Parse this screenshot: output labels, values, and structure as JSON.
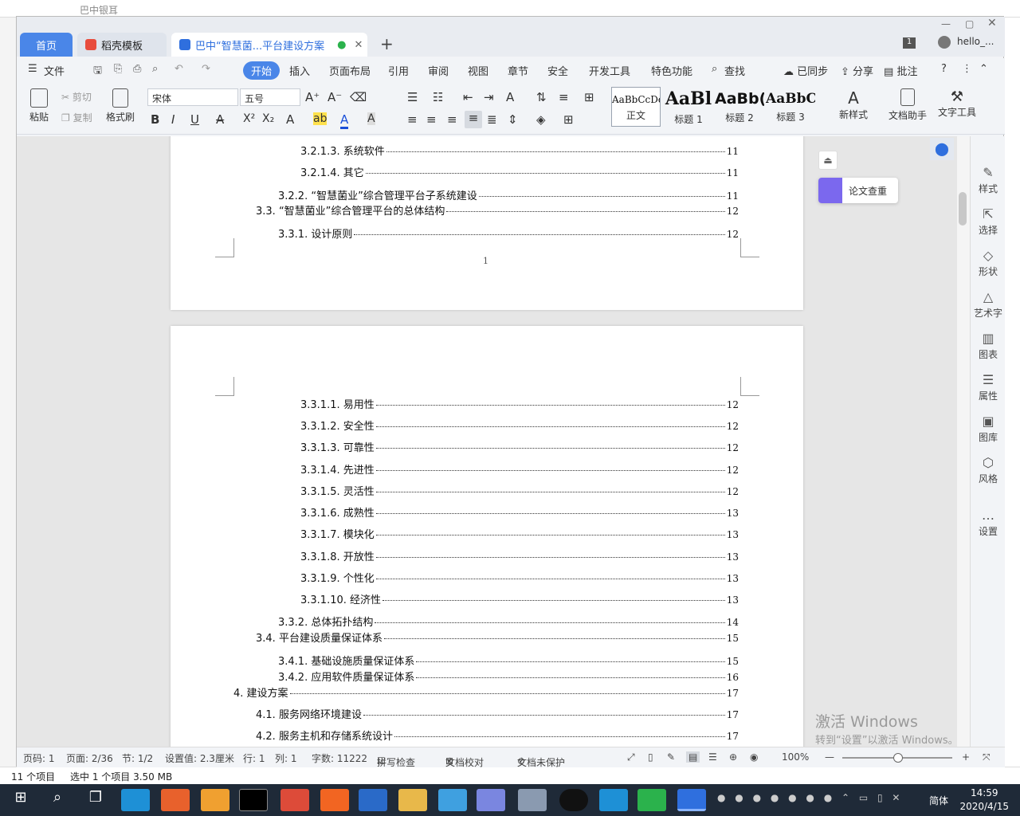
{
  "explorer": {
    "title": "巴中银耳",
    "status_items": "11 个项目",
    "status_selected": "选中 1 个项目  3.50 MB"
  },
  "tabs": {
    "home": "首页",
    "template": "稻壳模板",
    "doc": "巴中“智慧菌...平台建设方案",
    "page_badge": "1",
    "user": "hello_..."
  },
  "ribbon_tabs": [
    "文件",
    "开始",
    "插入",
    "页面布局",
    "引用",
    "审阅",
    "视图",
    "章节",
    "安全",
    "开发工具",
    "特色功能",
    "查找"
  ],
  "ribbon_right": {
    "sync": "已同步",
    "share": "分享",
    "comment": "批注"
  },
  "toolbar": {
    "paste": "粘贴",
    "cut": "剪切",
    "copy": "复制",
    "format_painter": "格式刷",
    "font": "宋体",
    "size": "五号",
    "styles": [
      {
        "preview": "AaBbCcDd",
        "label": "正文"
      },
      {
        "preview": "AaBl",
        "label": "标题 1"
      },
      {
        "preview": "AaBb(",
        "label": "标题 2"
      },
      {
        "preview": "AaBbC",
        "label": "标题 3"
      }
    ],
    "new_style": "新样式",
    "doc_assist": "文档助手",
    "text_tools": "文字工具"
  },
  "page1": {
    "toc": [
      {
        "text": "3.2.1.3.  系统软件",
        "page": "11"
      },
      {
        "text": "3.2.1.4.  其它",
        "page": "11"
      },
      {
        "text": "3.2.2.  “智慧菌业”综合管理平台子系统建设",
        "page": "11"
      },
      {
        "text": "3.3.  “智慧菌业”综合管理平台的总体结构",
        "page": "12"
      },
      {
        "text": "3.3.1.  设计原则",
        "page": "12"
      }
    ],
    "page_number": "1"
  },
  "page2": {
    "toc": [
      {
        "text": "3.3.1.1.  易用性",
        "page": "12"
      },
      {
        "text": "3.3.1.2.  安全性",
        "page": "12"
      },
      {
        "text": "3.3.1.3.  可靠性",
        "page": "12"
      },
      {
        "text": "3.3.1.4.  先进性",
        "page": "12"
      },
      {
        "text": "3.3.1.5.  灵活性",
        "page": "12"
      },
      {
        "text": "3.3.1.6.  成熟性",
        "page": "13"
      },
      {
        "text": "3.3.1.7.  模块化",
        "page": "13"
      },
      {
        "text": "3.3.1.8.  开放性",
        "page": "13"
      },
      {
        "text": "3.3.1.9.  个性化",
        "page": "13"
      },
      {
        "text": "3.3.1.10.  经济性",
        "page": "13"
      },
      {
        "text": "3.3.2.  总体拓扑结构",
        "page": "14"
      },
      {
        "text": "3.4.  平台建设质量保证体系",
        "page": "15"
      },
      {
        "text": "3.4.1.  基础设施质量保证体系",
        "page": "15"
      },
      {
        "text": "3.4.2.  应用软件质量保证体系",
        "page": "16"
      },
      {
        "text": "4.  建设方案",
        "page": "17"
      },
      {
        "text": "4.1.  服务网络环境建设",
        "page": "17"
      },
      {
        "text": "4.2.  服务主机和存储系统设计",
        "page": "17"
      }
    ]
  },
  "float": {
    "lunwen": "论文查重"
  },
  "sidebar": [
    "样式",
    "选择",
    "形状",
    "艺术字",
    "图表",
    "属性",
    "图库",
    "风格",
    "设置"
  ],
  "activate": {
    "line1": "激活 Windows",
    "line2": "转到“设置”以激活 Windows。"
  },
  "status": {
    "page_code": "页码: 1",
    "pages": "页面: 2/36",
    "section": "节: 1/2",
    "setting": "设置值: 2.3厘米",
    "row": "行: 1",
    "col": "列: 1",
    "words": "字数: 11222",
    "spell": "拼写检查",
    "proof": "文档校对",
    "protect": "文档未保护",
    "zoom": "100%"
  },
  "taskbar": {
    "time": "14:59",
    "date": "2020/4/15",
    "ime": "简体"
  }
}
